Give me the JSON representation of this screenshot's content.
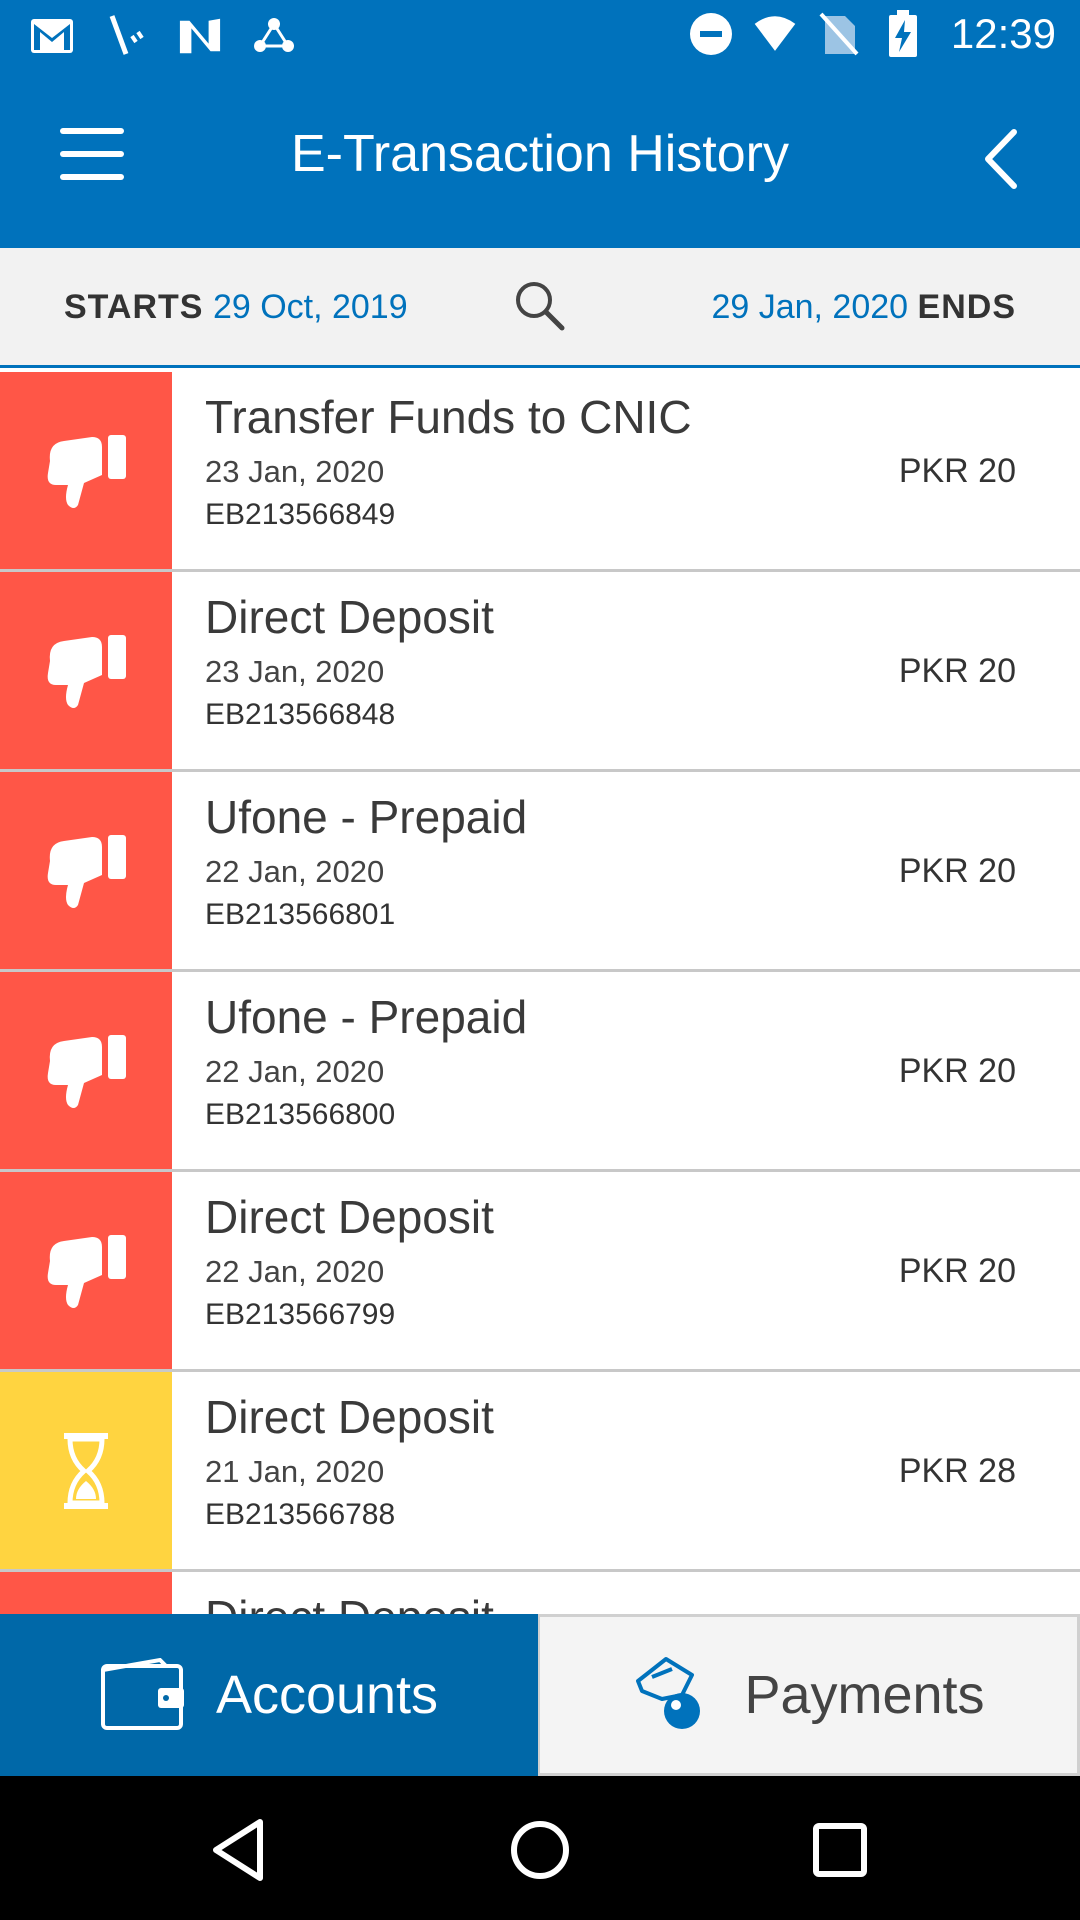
{
  "status_bar": {
    "time": "12:39",
    "left_icons": [
      "gmail-icon",
      "signal-tool-icon",
      "n-app-icon",
      "share-app-icon"
    ],
    "right_icons": [
      "do-not-disturb-icon",
      "wifi-icon",
      "no-sim-icon",
      "battery-charging-icon"
    ]
  },
  "header": {
    "title": "E-Transaction History"
  },
  "date_range": {
    "starts_label": "STARTS",
    "start_date": "29 Oct, 2019",
    "end_date": "29 Jan, 2020",
    "ends_label": "ENDS"
  },
  "transactions": [
    {
      "title": "Transfer Funds to CNIC",
      "date": "23 Jan, 2020",
      "ref": "EB213566849",
      "amount": "PKR 20",
      "status": "failed"
    },
    {
      "title": "Direct Deposit",
      "date": "23 Jan, 2020",
      "ref": "EB213566848",
      "amount": "PKR 20",
      "status": "failed"
    },
    {
      "title": "Ufone - Prepaid",
      "date": "22 Jan, 2020",
      "ref": "EB213566801",
      "amount": "PKR 20",
      "status": "failed"
    },
    {
      "title": "Ufone - Prepaid",
      "date": "22 Jan, 2020",
      "ref": "EB213566800",
      "amount": "PKR 20",
      "status": "failed"
    },
    {
      "title": "Direct Deposit",
      "date": "22 Jan, 2020",
      "ref": "EB213566799",
      "amount": "PKR 20",
      "status": "failed"
    },
    {
      "title": "Direct Deposit",
      "date": "21 Jan, 2020",
      "ref": "EB213566788",
      "amount": "PKR 28",
      "status": "pending"
    },
    {
      "title": "Direct Deposit",
      "date": "",
      "ref": "",
      "amount": "",
      "status": "failed"
    }
  ],
  "tabs": {
    "accounts_label": "Accounts",
    "payments_label": "Payments"
  },
  "colors": {
    "primary": "#0072BC",
    "failed": "#FF5647",
    "pending": "#FFD440",
    "tab_active": "#0068A8"
  }
}
